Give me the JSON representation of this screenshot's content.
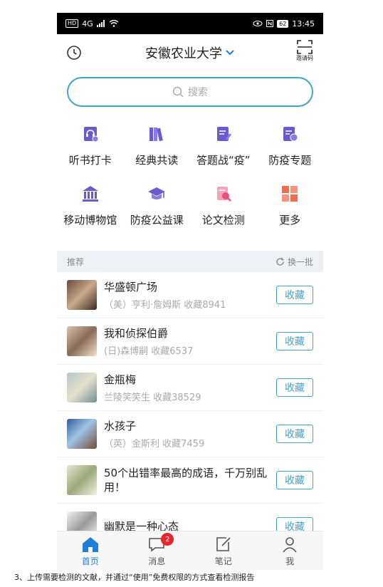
{
  "status_bar": {
    "left_chip": "HD",
    "network": "4G",
    "battery": "62",
    "time": "13:45"
  },
  "header": {
    "title": "安徽农业大学",
    "invite_label": "邀请码"
  },
  "search": {
    "placeholder": "搜索"
  },
  "features": [
    {
      "label": "听书打卡",
      "icon": "headphone-book-icon",
      "color": "#6a5acd"
    },
    {
      "label": "经典共读",
      "icon": "books-icon",
      "color": "#6a5acd"
    },
    {
      "label": "答题战“疫”",
      "icon": "quiz-icon",
      "color": "#6a5acd"
    },
    {
      "label": "防疫专题",
      "icon": "topic-icon",
      "color": "#6a5acd"
    },
    {
      "label": "移动博物馆",
      "icon": "museum-icon",
      "color": "#6a5acd"
    },
    {
      "label": "防疫公益课",
      "icon": "graduation-cap-icon",
      "color": "#6a5acd"
    },
    {
      "label": "论文检测",
      "icon": "paper-check-icon",
      "color": "#e8507a"
    },
    {
      "label": "更多",
      "icon": "more-grid-icon",
      "color": "#f26b4f"
    }
  ],
  "recommend": {
    "title": "推荐",
    "refresh_label": "换一批"
  },
  "books": [
    {
      "title": "华盛顿广场",
      "subtitle": "（美）亨利·詹姆斯 收藏8941",
      "action": "收藏"
    },
    {
      "title": "我和侦探伯爵",
      "subtitle": "(日)森博嗣 收藏6537",
      "action": "收藏"
    },
    {
      "title": "金瓶梅",
      "subtitle": "兰陵笑笑生 收藏38529",
      "action": "收藏"
    },
    {
      "title": "水孩子",
      "subtitle": "（英）金斯利 收藏7459",
      "action": "收藏"
    },
    {
      "title": "50个出错率最高的成语，千万别乱用！",
      "subtitle": "",
      "action": "收藏"
    },
    {
      "title": "幽默是一种心态",
      "subtitle": "",
      "action": "收藏"
    }
  ],
  "tabs": [
    {
      "label": "首页",
      "icon": "home-icon"
    },
    {
      "label": "消息",
      "icon": "message-icon",
      "badge": "2"
    },
    {
      "label": "笔记",
      "icon": "note-icon"
    },
    {
      "label": "我",
      "icon": "profile-icon"
    }
  ],
  "caption": "3、上传需要检测的文献，并通过“使用”免费权限的方式查看检测报告",
  "colors": {
    "accent": "#3fa4c8",
    "tab_active": "#1e7fd6",
    "badge": "#e7262c"
  }
}
